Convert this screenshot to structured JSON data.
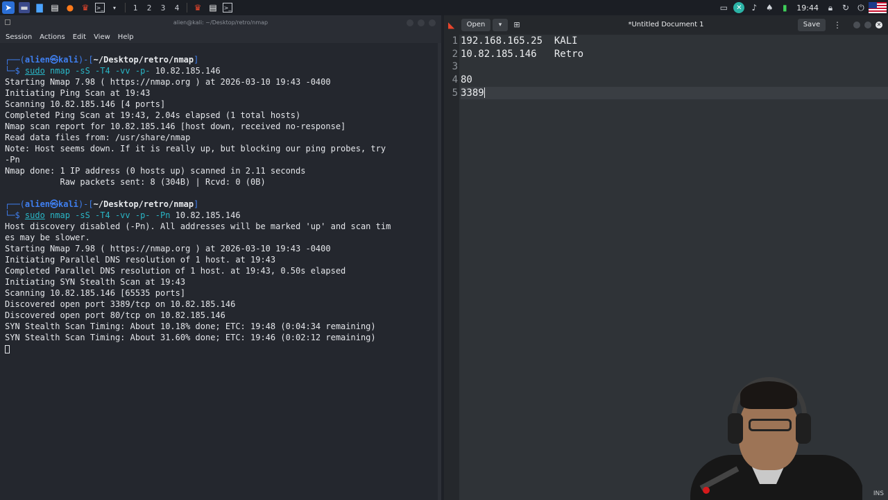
{
  "taskbar": {
    "workspaces": [
      "1",
      "2",
      "3",
      "4"
    ],
    "clock": "19:44"
  },
  "terminal": {
    "title": "alien@kali: ~/Desktop/retro/nmap",
    "menu": [
      "Session",
      "Actions",
      "Edit",
      "View",
      "Help"
    ],
    "prompt": {
      "user": "alien",
      "at": "㉿",
      "host": "kali",
      "path": "~/Desktop/retro/nmap"
    },
    "blocks": [
      {
        "command": "sudo nmap -sS -T4 -vv -p- 10.82.185.146",
        "output": [
          "Starting Nmap 7.98 ( https://nmap.org ) at 2026-03-10 19:43 -0400",
          "Initiating Ping Scan at 19:43",
          "Scanning 10.82.185.146 [4 ports]",
          "Completed Ping Scan at 19:43, 2.04s elapsed (1 total hosts)",
          "Nmap scan report for 10.82.185.146 [host down, received no-response]",
          "Read data files from: /usr/share/nmap",
          "Note: Host seems down. If it is really up, but blocking our ping probes, try",
          "-Pn",
          "Nmap done: 1 IP address (0 hosts up) scanned in 2.11 seconds",
          "           Raw packets sent: 8 (304B) | Rcvd: 0 (0B)"
        ]
      },
      {
        "command": "sudo nmap -sS -T4 -vv -p- -Pn 10.82.185.146",
        "output": [
          "Host discovery disabled (-Pn). All addresses will be marked 'up' and scan tim",
          "es may be slower.",
          "Starting Nmap 7.98 ( https://nmap.org ) at 2026-03-10 19:43 -0400",
          "Initiating Parallel DNS resolution of 1 host. at 19:43",
          "Completed Parallel DNS resolution of 1 host. at 19:43, 0.50s elapsed",
          "Initiating SYN Stealth Scan at 19:43",
          "Scanning 10.82.185.146 [65535 ports]",
          "Discovered open port 3389/tcp on 10.82.185.146",
          "Discovered open port 80/tcp on 10.82.185.146",
          "SYN Stealth Scan Timing: About 10.18% done; ETC: 19:48 (0:04:34 remaining)",
          "SYN Stealth Scan Timing: About 31.60% done; ETC: 19:46 (0:02:12 remaining)"
        ]
      }
    ]
  },
  "editor": {
    "open_label": "Open",
    "doc_title": "*Untitled Document 1",
    "save_label": "Save",
    "line_numbers": [
      "1",
      "2",
      "3",
      "4",
      "5"
    ],
    "lines": [
      "192.168.165.25  KALI",
      "10.82.185.146   Retro",
      "",
      "80",
      "3389"
    ],
    "status_mode": "INS"
  }
}
